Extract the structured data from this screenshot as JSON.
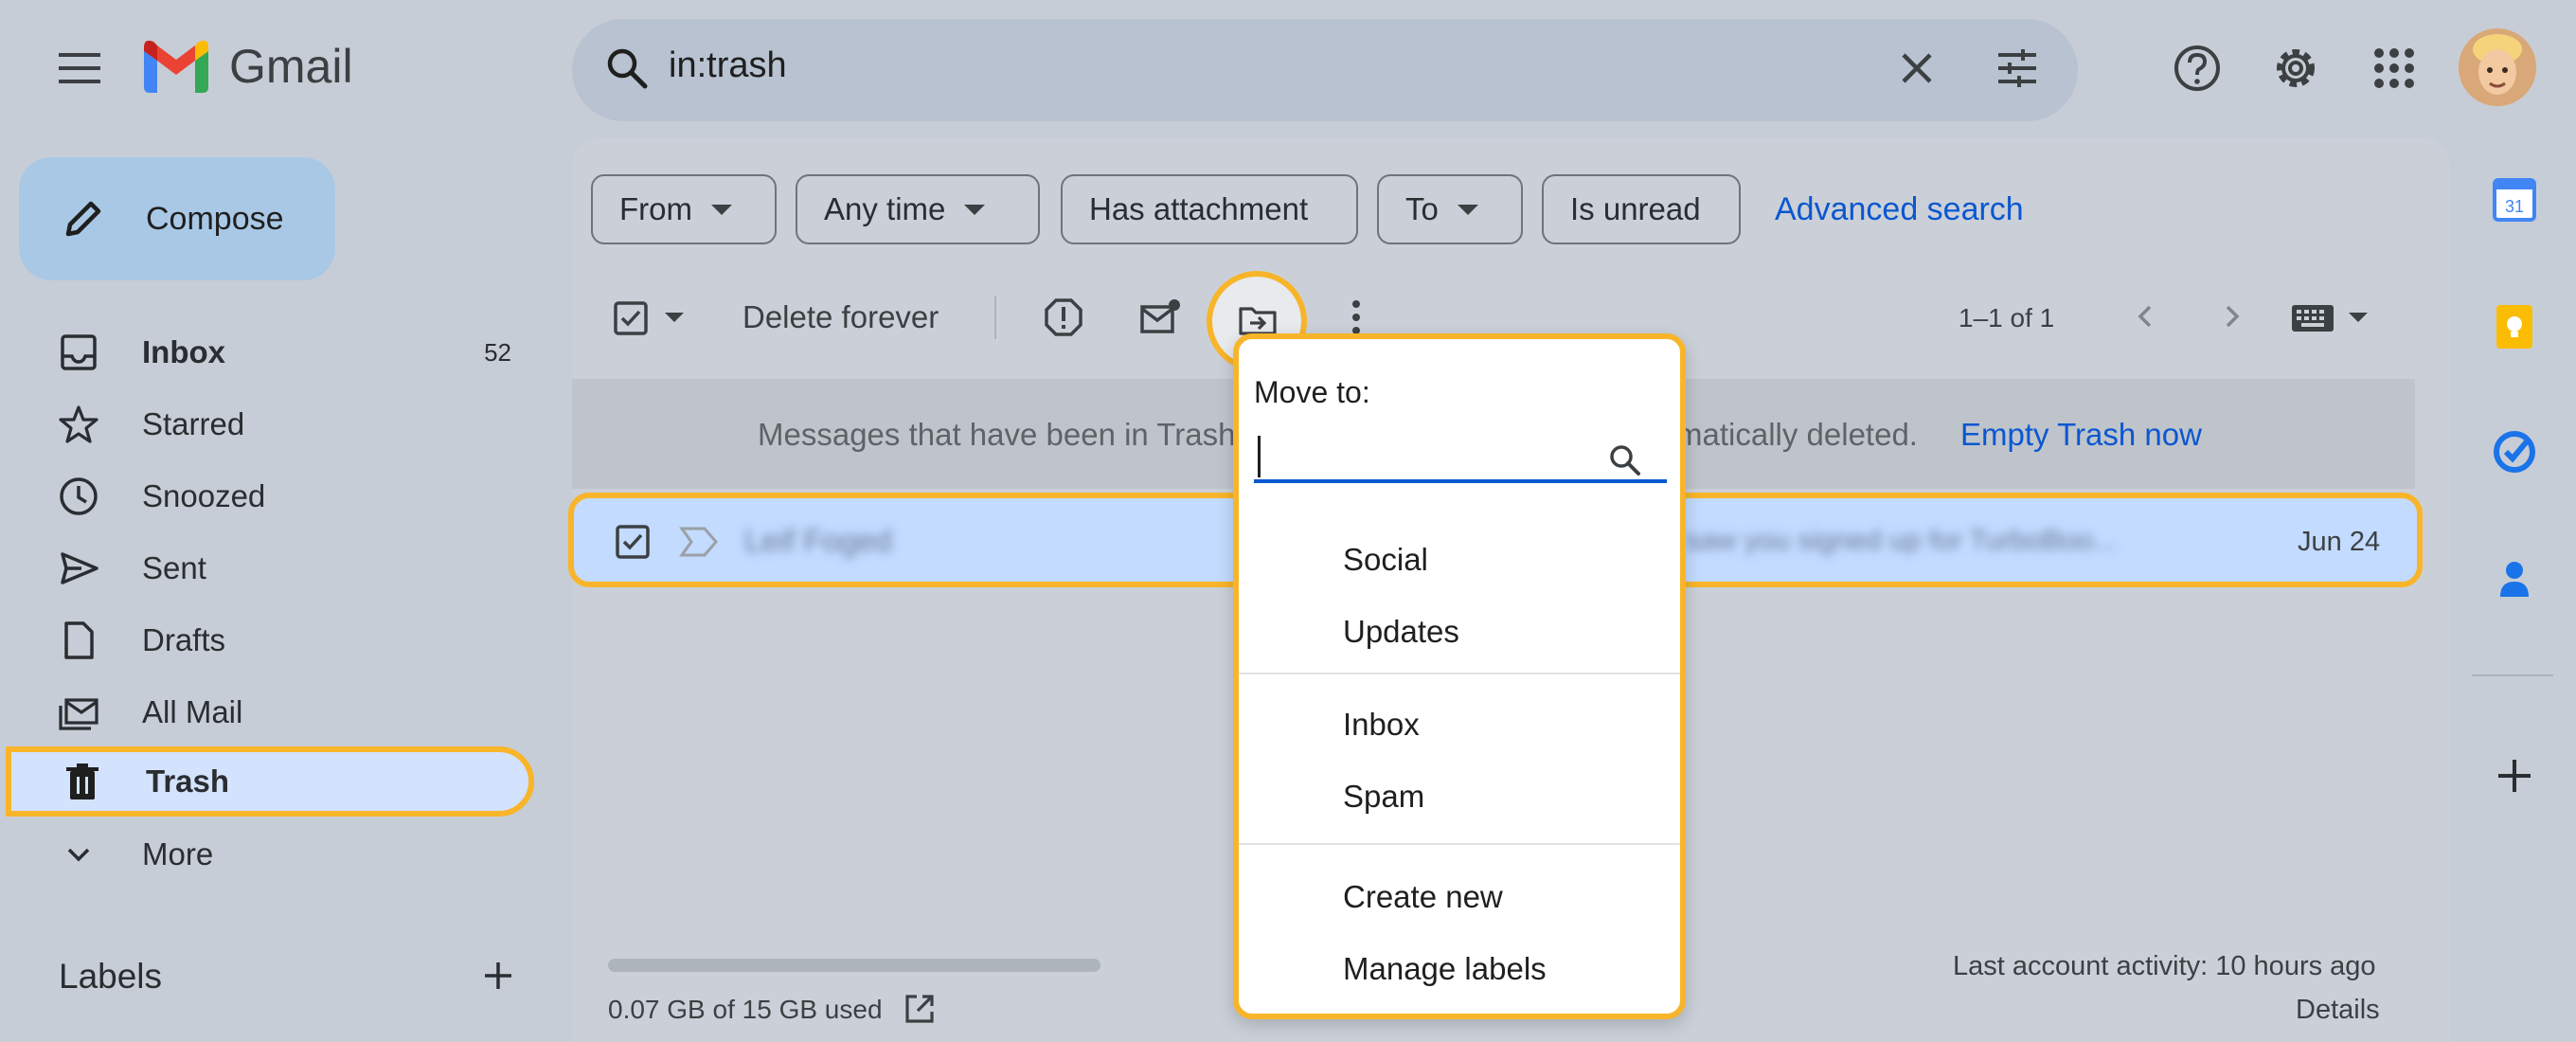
{
  "header": {
    "app_name": "Gmail",
    "search_query": "in:trash"
  },
  "sidebar": {
    "compose_label": "Compose",
    "items": [
      {
        "label": "Inbox",
        "count": "52"
      },
      {
        "label": "Starred"
      },
      {
        "label": "Snoozed"
      },
      {
        "label": "Sent"
      },
      {
        "label": "Drafts"
      },
      {
        "label": "All Mail"
      },
      {
        "label": "Trash"
      },
      {
        "label": "More"
      }
    ],
    "labels_title": "Labels"
  },
  "filters": {
    "chips": [
      "From",
      "Any time",
      "Has attachment",
      "To",
      "Is unread"
    ],
    "advanced_search": "Advanced search"
  },
  "toolbar": {
    "delete_forever": "Delete forever",
    "pager": "1–1 of 1"
  },
  "banner": {
    "text_left": "Messages that have been in Trash",
    "text_right": "matically deleted.",
    "link": "Empty Trash now"
  },
  "row": {
    "sender": "Leif Foged",
    "snippet": "saw you signed up for TurboBoo...",
    "date": "Jun 24"
  },
  "footer": {
    "storage": "0.07 GB of 15 GB used",
    "storage_fraction": 0.005,
    "activity": "Last account activity: 10 hours ago",
    "details": "Details"
  },
  "move_to": {
    "title": "Move to:",
    "search_value": "",
    "items": [
      "Social",
      "Updates",
      "Inbox",
      "Spam",
      "Create new",
      "Manage labels"
    ]
  },
  "colors": {
    "highlight": "#f8b52a",
    "selected_row": "#c2dbff",
    "link": "#0b57d0"
  }
}
